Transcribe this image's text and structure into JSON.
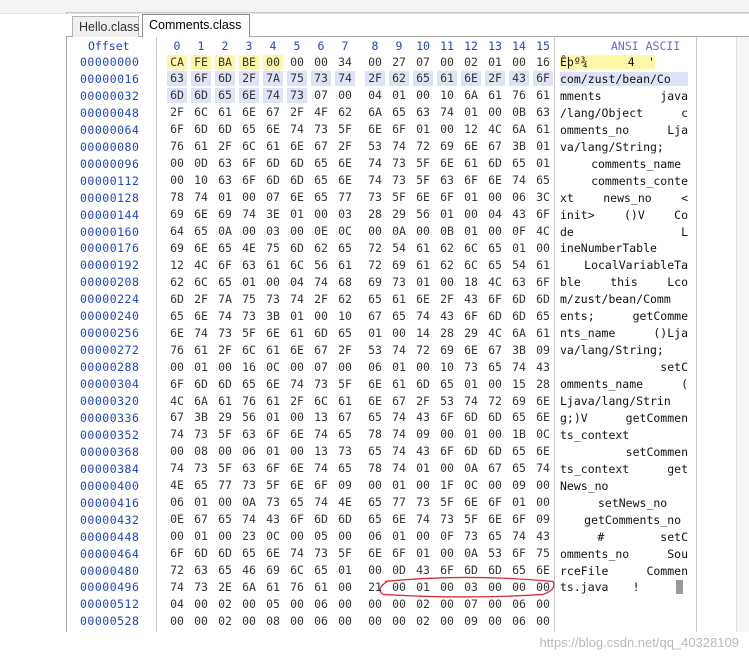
{
  "tabs": [
    {
      "label": "Hello.class",
      "active": false
    },
    {
      "label": "Comments.class",
      "active": true
    }
  ],
  "header": {
    "offset_label": "Offset",
    "columns": [
      "0",
      "1",
      "2",
      "3",
      "4",
      "5",
      "6",
      "7",
      "8",
      "9",
      "10",
      "11",
      "12",
      "13",
      "14",
      "15"
    ],
    "ascii_label": "ANSI ASCII"
  },
  "rows": [
    {
      "offset": "00000000",
      "bytes": [
        "CA",
        "FE",
        "BA",
        "BE",
        "00",
        "00",
        "00",
        "34",
        "00",
        "27",
        "07",
        "00",
        "02",
        "01",
        "00",
        "16"
      ],
      "ascii": "Êþº¾   4 '"
    },
    {
      "offset": "00000016",
      "bytes": [
        "63",
        "6F",
        "6D",
        "2F",
        "7A",
        "75",
        "73",
        "74",
        "2F",
        "62",
        "65",
        "61",
        "6E",
        "2F",
        "43",
        "6F"
      ],
      "ascii": "com/zust/bean/Co"
    },
    {
      "offset": "00000032",
      "bytes": [
        "6D",
        "6D",
        "65",
        "6E",
        "74",
        "73",
        "07",
        "00",
        "04",
        "01",
        "00",
        "10",
        "6A",
        "61",
        "76",
        "61"
      ],
      "ascii": "mments      java"
    },
    {
      "offset": "00000048",
      "bytes": [
        "2F",
        "6C",
        "61",
        "6E",
        "67",
        "2F",
        "4F",
        "62",
        "6A",
        "65",
        "63",
        "74",
        "01",
        "00",
        "0B",
        "63"
      ],
      "ascii": "/lang/Object   c"
    },
    {
      "offset": "00000064",
      "bytes": [
        "6F",
        "6D",
        "6D",
        "65",
        "6E",
        "74",
        "73",
        "5F",
        "6E",
        "6F",
        "01",
        "00",
        "12",
        "4C",
        "6A",
        "61"
      ],
      "ascii": "omments_no   Lja"
    },
    {
      "offset": "00000080",
      "bytes": [
        "76",
        "61",
        "2F",
        "6C",
        "61",
        "6E",
        "67",
        "2F",
        "53",
        "74",
        "72",
        "69",
        "6E",
        "67",
        "3B",
        "01"
      ],
      "ascii": "va/lang/String; "
    },
    {
      "offset": "00000096",
      "bytes": [
        "00",
        "0D",
        "63",
        "6F",
        "6D",
        "6D",
        "65",
        "6E",
        "74",
        "73",
        "5F",
        "6E",
        "61",
        "6D",
        "65",
        "01"
      ],
      "ascii": "  comments_name "
    },
    {
      "offset": "00000112",
      "bytes": [
        "00",
        "10",
        "63",
        "6F",
        "6D",
        "6D",
        "65",
        "6E",
        "74",
        "73",
        "5F",
        "63",
        "6F",
        "6E",
        "74",
        "65"
      ],
      "ascii": "  comments_conte"
    },
    {
      "offset": "00000128",
      "bytes": [
        "78",
        "74",
        "01",
        "00",
        "07",
        "6E",
        "65",
        "77",
        "73",
        "5F",
        "6E",
        "6F",
        "01",
        "00",
        "06",
        "3C"
      ],
      "ascii": "xt   news_no   <"
    },
    {
      "offset": "00000144",
      "bytes": [
        "69",
        "6E",
        "69",
        "74",
        "3E",
        "01",
        "00",
        "03",
        "28",
        "29",
        "56",
        "01",
        "00",
        "04",
        "43",
        "6F"
      ],
      "ascii": "init>   ()V   Co"
    },
    {
      "offset": "00000160",
      "bytes": [
        "64",
        "65",
        "0A",
        "00",
        "03",
        "00",
        "0E",
        "0C",
        "00",
        "0A",
        "00",
        "0B",
        "01",
        "00",
        "0F",
        "4C"
      ],
      "ascii": "de             L"
    },
    {
      "offset": "00000176",
      "bytes": [
        "69",
        "6E",
        "65",
        "4E",
        "75",
        "6D",
        "62",
        "65",
        "72",
        "54",
        "61",
        "62",
        "6C",
        "65",
        "01",
        "00"
      ],
      "ascii": "ineNumberTable  "
    },
    {
      "offset": "00000192",
      "bytes": [
        "12",
        "4C",
        "6F",
        "63",
        "61",
        "6C",
        "56",
        "61",
        "72",
        "69",
        "61",
        "62",
        "6C",
        "65",
        "54",
        "61"
      ],
      "ascii": " LocalVariableTa"
    },
    {
      "offset": "00000208",
      "bytes": [
        "62",
        "6C",
        "65",
        "01",
        "00",
        "04",
        "74",
        "68",
        "69",
        "73",
        "01",
        "00",
        "18",
        "4C",
        "63",
        "6F"
      ],
      "ascii": "ble   this   Lco"
    },
    {
      "offset": "00000224",
      "bytes": [
        "6D",
        "2F",
        "7A",
        "75",
        "73",
        "74",
        "2F",
        "62",
        "65",
        "61",
        "6E",
        "2F",
        "43",
        "6F",
        "6D",
        "6D"
      ],
      "ascii": "m/zust/bean/Comm"
    },
    {
      "offset": "00000240",
      "bytes": [
        "65",
        "6E",
        "74",
        "73",
        "3B",
        "01",
        "00",
        "10",
        "67",
        "65",
        "74",
        "43",
        "6F",
        "6D",
        "6D",
        "65"
      ],
      "ascii": "ents;   getComme"
    },
    {
      "offset": "00000256",
      "bytes": [
        "6E",
        "74",
        "73",
        "5F",
        "6E",
        "61",
        "6D",
        "65",
        "01",
        "00",
        "14",
        "28",
        "29",
        "4C",
        "6A",
        "61"
      ],
      "ascii": "nts_name   ()Lja"
    },
    {
      "offset": "00000272",
      "bytes": [
        "76",
        "61",
        "2F",
        "6C",
        "61",
        "6E",
        "67",
        "2F",
        "53",
        "74",
        "72",
        "69",
        "6E",
        "67",
        "3B",
        "09"
      ],
      "ascii": "va/lang/String; "
    },
    {
      "offset": "00000288",
      "bytes": [
        "00",
        "01",
        "00",
        "16",
        "0C",
        "00",
        "07",
        "00",
        "06",
        "01",
        "00",
        "10",
        "73",
        "65",
        "74",
        "43"
      ],
      "ascii": "            setC"
    },
    {
      "offset": "00000304",
      "bytes": [
        "6F",
        "6D",
        "6D",
        "65",
        "6E",
        "74",
        "73",
        "5F",
        "6E",
        "61",
        "6D",
        "65",
        "01",
        "00",
        "15",
        "28"
      ],
      "ascii": "omments_name   ("
    },
    {
      "offset": "00000320",
      "bytes": [
        "4C",
        "6A",
        "61",
        "76",
        "61",
        "2F",
        "6C",
        "61",
        "6E",
        "67",
        "2F",
        "53",
        "74",
        "72",
        "69",
        "6E"
      ],
      "ascii": "Ljava/lang/Strin"
    },
    {
      "offset": "00000336",
      "bytes": [
        "67",
        "3B",
        "29",
        "56",
        "01",
        "00",
        "13",
        "67",
        "65",
        "74",
        "43",
        "6F",
        "6D",
        "6D",
        "65",
        "6E"
      ],
      "ascii": "g;)V   getCommen"
    },
    {
      "offset": "00000352",
      "bytes": [
        "74",
        "73",
        "5F",
        "63",
        "6F",
        "6E",
        "74",
        "65",
        "78",
        "74",
        "09",
        "00",
        "01",
        "00",
        "1B",
        "0C"
      ],
      "ascii": "ts_context      "
    },
    {
      "offset": "00000368",
      "bytes": [
        "00",
        "08",
        "00",
        "06",
        "01",
        "00",
        "13",
        "73",
        "65",
        "74",
        "43",
        "6F",
        "6D",
        "6D",
        "65",
        "6E"
      ],
      "ascii": "       setCommen"
    },
    {
      "offset": "00000384",
      "bytes": [
        "74",
        "73",
        "5F",
        "63",
        "6F",
        "6E",
        "74",
        "65",
        "78",
        "74",
        "01",
        "00",
        "0A",
        "67",
        "65",
        "74"
      ],
      "ascii": "ts_context   get"
    },
    {
      "offset": "00000400",
      "bytes": [
        "4E",
        "65",
        "77",
        "73",
        "5F",
        "6E",
        "6F",
        "09",
        "00",
        "01",
        "00",
        "1F",
        "0C",
        "00",
        "09",
        "00"
      ],
      "ascii": "News_no         "
    },
    {
      "offset": "00000416",
      "bytes": [
        "06",
        "01",
        "00",
        "0A",
        "73",
        "65",
        "74",
        "4E",
        "65",
        "77",
        "73",
        "5F",
        "6E",
        "6F",
        "01",
        "00"
      ],
      "ascii": "   setNews_no   "
    },
    {
      "offset": "00000432",
      "bytes": [
        "0E",
        "67",
        "65",
        "74",
        "43",
        "6F",
        "6D",
        "6D",
        "65",
        "6E",
        "74",
        "73",
        "5F",
        "6E",
        "6F",
        "09"
      ],
      "ascii": " getComments_no "
    },
    {
      "offset": "00000448",
      "bytes": [
        "00",
        "01",
        "00",
        "23",
        "0C",
        "00",
        "05",
        "00",
        "06",
        "01",
        "00",
        "0F",
        "73",
        "65",
        "74",
        "43"
      ],
      "ascii": "    #      setC"
    },
    {
      "offset": "00000464",
      "bytes": [
        "6F",
        "6D",
        "6D",
        "65",
        "6E",
        "74",
        "73",
        "5F",
        "6E",
        "6F",
        "01",
        "00",
        "0A",
        "53",
        "6F",
        "75"
      ],
      "ascii": "omments_no   Sou"
    },
    {
      "offset": "00000480",
      "bytes": [
        "72",
        "63",
        "65",
        "46",
        "69",
        "6C",
        "65",
        "01",
        "00",
        "0D",
        "43",
        "6F",
        "6D",
        "6D",
        "65",
        "6E"
      ],
      "ascii": "rceFile   Commen"
    },
    {
      "offset": "00000496",
      "bytes": [
        "74",
        "73",
        "2E",
        "6A",
        "61",
        "76",
        "61",
        "00",
        "21",
        "00",
        "01",
        "00",
        "03",
        "00",
        "00",
        "00"
      ],
      "ascii": "ts.java !       "
    },
    {
      "offset": "00000512",
      "bytes": [
        "04",
        "00",
        "02",
        "00",
        "05",
        "00",
        "06",
        "00",
        "00",
        "00",
        "02",
        "00",
        "07",
        "00",
        "06",
        "00"
      ],
      "ascii": ""
    },
    {
      "offset": "00000528",
      "bytes": [
        "00",
        "00",
        "02",
        "00",
        "08",
        "00",
        "06",
        "00",
        "00",
        "00",
        "02",
        "00",
        "09",
        "00",
        "06",
        "00"
      ],
      "ascii": ""
    }
  ],
  "watermark": "https://blog.csdn.net/qq_40328109",
  "colors": {
    "accent_blue": "#1e46c8",
    "highlight_yellow": "#fff7a8",
    "highlight_blue": "#dfe3f7",
    "annotation_red": "#d9303a"
  }
}
